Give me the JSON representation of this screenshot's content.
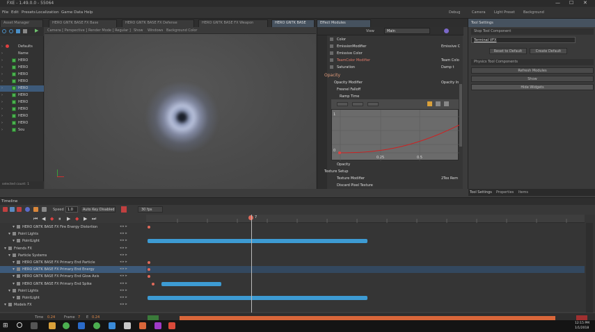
{
  "app": {
    "title": "FXE - 1.49.0.0 - 55064",
    "window_controls": [
      "—",
      "☐",
      "✕"
    ]
  },
  "menu": {
    "items": [
      "File",
      "Edit",
      "Presets",
      "Localization",
      "Game Data",
      "Help"
    ],
    "right": [
      "Debug",
      "Camera",
      "Light Preset",
      "Background"
    ]
  },
  "tabs": [
    {
      "label": "HERO GNTK BASE FX Base",
      "active": false
    },
    {
      "label": "HERO GNTK BASE FX Defense",
      "active": false
    },
    {
      "label": "HERO GNTK BASE FX Weapon",
      "active": false
    },
    {
      "label": "HERO GNTK BASE",
      "active": true
    }
  ],
  "effect_tab": {
    "label": "Effect Modules"
  },
  "tool_tab": {
    "label": "Tool Settings"
  },
  "left_panel": {
    "header": "Asset Manager",
    "rows": [
      {
        "label": "Defaults",
        "selected": false
      },
      {
        "label": "Name",
        "selected": false
      },
      {
        "label": "HERO",
        "selected": false
      },
      {
        "label": "HERO",
        "selected": false
      },
      {
        "label": "HERO",
        "selected": false
      },
      {
        "label": "HERO",
        "selected": false
      },
      {
        "label": "HERO",
        "selected": true
      },
      {
        "label": "HERO",
        "selected": false
      },
      {
        "label": "HERO",
        "selected": false
      },
      {
        "label": "HERO",
        "selected": false
      },
      {
        "label": "HERO",
        "selected": false
      },
      {
        "label": "HERO",
        "selected": false
      },
      {
        "label": "Sou",
        "selected": false
      }
    ],
    "footer": "selected count: 1"
  },
  "viewport": {
    "toolbar": [
      "Camera [ Perspective ]",
      "Render Mode [ Regular ]",
      "Show",
      "Windows",
      "Background Color"
    ]
  },
  "effect_panel": {
    "view_label": "View",
    "view_value": "Main",
    "rows": [
      {
        "label": "Color",
        "value": "",
        "color": "#ddd"
      },
      {
        "label": "EmissionModifier",
        "value": "Emissive C",
        "color": "#ddd"
      },
      {
        "label": "Emissive Color",
        "value": "",
        "color": "#ddd"
      },
      {
        "label": "TeamColor Modifier",
        "value": "Team Colo",
        "color": "#e07a6a"
      },
      {
        "label": "Saturation",
        "value": "Damp t",
        "color": "#ddd"
      }
    ],
    "opacity_section": "Opacity",
    "opacity_rows": [
      {
        "label": "Opacity Modifier",
        "value": "Opacity In"
      },
      {
        "label": "Fresnel Falloff",
        "value": ""
      },
      {
        "label": "Ramp Time",
        "value": ""
      }
    ],
    "curve_ticks": [
      "0.25",
      "0.5"
    ],
    "curve_labels": [
      "1",
      "0"
    ],
    "bottom_rows": [
      {
        "label": "Opacity",
        "value": ""
      },
      {
        "label": "Texture Setup",
        "value": ""
      },
      {
        "label": "Texture Modifier",
        "value": "2Tex Rem"
      },
      {
        "label": "Discard Pixel Texture",
        "value": ""
      }
    ]
  },
  "tool_panel": {
    "section1": "Stop Tool Component",
    "input_value": "Terminal VFX",
    "btn_a": "Reset to Default",
    "btn_b": "Create Default",
    "section2": "Physics Tool Components",
    "btn_c": "Refresh Modules",
    "btn_d": "Show",
    "btn_e": "Hide Widgets",
    "tabs": [
      "Tool Settings",
      "Properties",
      "Items"
    ]
  },
  "timeline": {
    "header": "Timeline",
    "speed_label": "Speed",
    "speed_value": "1.0",
    "auto_key": "Auto Key Disabled",
    "fps": "30 fps",
    "frame_marker": "7",
    "rows": [
      {
        "label": "HERO GNTK BASE FX Fire Energy Distortion",
        "indent": 3,
        "selected": false
      },
      {
        "label": "Point Lights",
        "indent": 2,
        "selected": false
      },
      {
        "label": "PointLight",
        "indent": 3,
        "selected": false
      },
      {
        "label": "Friends FX",
        "indent": 1,
        "selected": false
      },
      {
        "label": "Particle Systems",
        "indent": 2,
        "selected": false
      },
      {
        "label": "HERO GNTK BASE FX Primary End Particle",
        "indent": 3,
        "selected": false
      },
      {
        "label": "HERO GNTK BASE FX Primary End Energy",
        "indent": 3,
        "selected": true
      },
      {
        "label": "HERO GNTK BASE FX Primary End Glow Axis",
        "indent": 3,
        "selected": false
      },
      {
        "label": "HERO GNTK BASE FX Primary End Spike",
        "indent": 3,
        "selected": false
      },
      {
        "label": "Point Lights",
        "indent": 2,
        "selected": false
      },
      {
        "label": "PointLight",
        "indent": 3,
        "selected": false
      },
      {
        "label": "Models FX",
        "indent": 1,
        "selected": false
      }
    ],
    "time_label": "Time",
    "time_value": "0.24",
    "frame_label": "Frame",
    "frame_value": "7",
    "end_label": "E",
    "end_value": "0.24"
  },
  "taskbar": {
    "time": "12:15 PM",
    "date": "1/1/2018"
  },
  "colors": {
    "accent": "#3d5a7a",
    "bar": "#3d9bd3",
    "key": "#e06a5a",
    "orange": "#d9663a",
    "curve": "#d02020"
  }
}
